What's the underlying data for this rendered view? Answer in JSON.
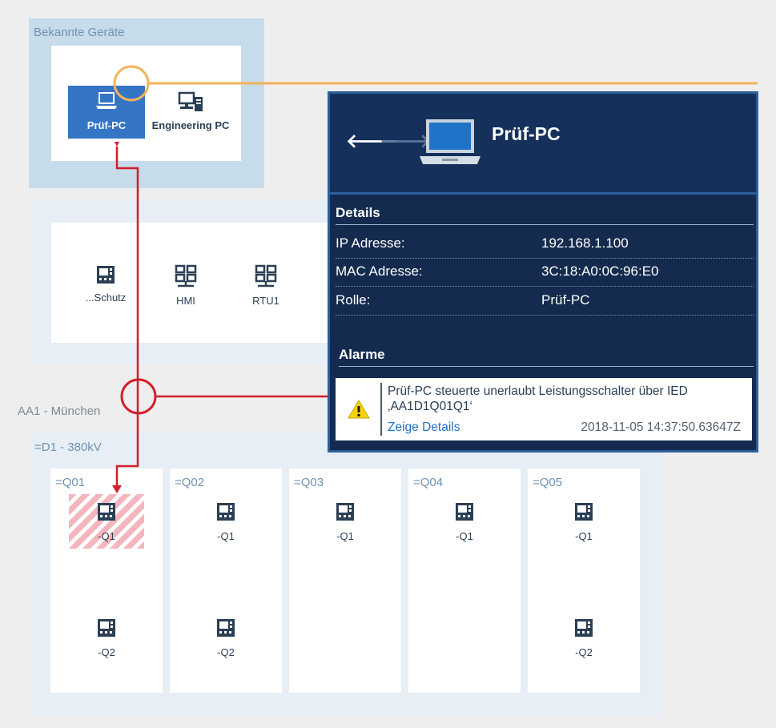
{
  "known_devices": {
    "title": "Bekannte Geräte",
    "devices": [
      {
        "label": "Prüf-PC",
        "icon": "laptop-icon",
        "selected": true
      },
      {
        "label": "Engineering PC",
        "icon": "desktop-pc-icon",
        "selected": false
      }
    ]
  },
  "station_devices": [
    {
      "label": "...Schutz",
      "icon": "ied-icon"
    },
    {
      "label": "HMI",
      "icon": "network-icon"
    },
    {
      "label": "RTU1",
      "icon": "network-icon"
    }
  ],
  "substation": {
    "label": "AA1 - München",
    "voltage_level": "=D1 - 380kV",
    "bays": [
      {
        "name": "=Q01",
        "items": [
          {
            "label": "-Q1",
            "alarm": true
          },
          {
            "label": "-Q2",
            "alarm": false
          }
        ]
      },
      {
        "name": "=Q02",
        "items": [
          {
            "label": "-Q1",
            "alarm": false
          },
          {
            "label": "-Q2",
            "alarm": false
          }
        ]
      },
      {
        "name": "=Q03",
        "items": [
          {
            "label": "-Q1",
            "alarm": false
          }
        ]
      },
      {
        "name": "=Q04",
        "items": [
          {
            "label": "-Q1",
            "alarm": false
          }
        ]
      },
      {
        "name": "=Q05",
        "items": [
          {
            "label": "-Q1",
            "alarm": false
          },
          {
            "label": "-Q2",
            "alarm": false
          }
        ]
      }
    ]
  },
  "detail_panel": {
    "title": "Prüf-PC",
    "details_heading": "Details",
    "details": [
      {
        "key": "IP Adresse:",
        "value": "192.168.1.100"
      },
      {
        "key": "MAC Adresse:",
        "value": "3C:18:A0:0C:96:E0"
      },
      {
        "key": "Rolle:",
        "value": "Prüf-PC"
      }
    ],
    "alarms_heading": "Alarme",
    "alarm": {
      "message": "Prüf-PC steuerte unerlaubt Leistungsschalter über IED ‚AA1D1Q01Q1‘",
      "link": "Zeige Details",
      "timestamp": "2018-11-05 14:37:50.63647Z"
    }
  },
  "colors": {
    "accent_orange": "#f2b35a",
    "alert_red": "#d21f2b",
    "panel_navy": "#142b4f",
    "selected_blue": "#3475c4"
  }
}
